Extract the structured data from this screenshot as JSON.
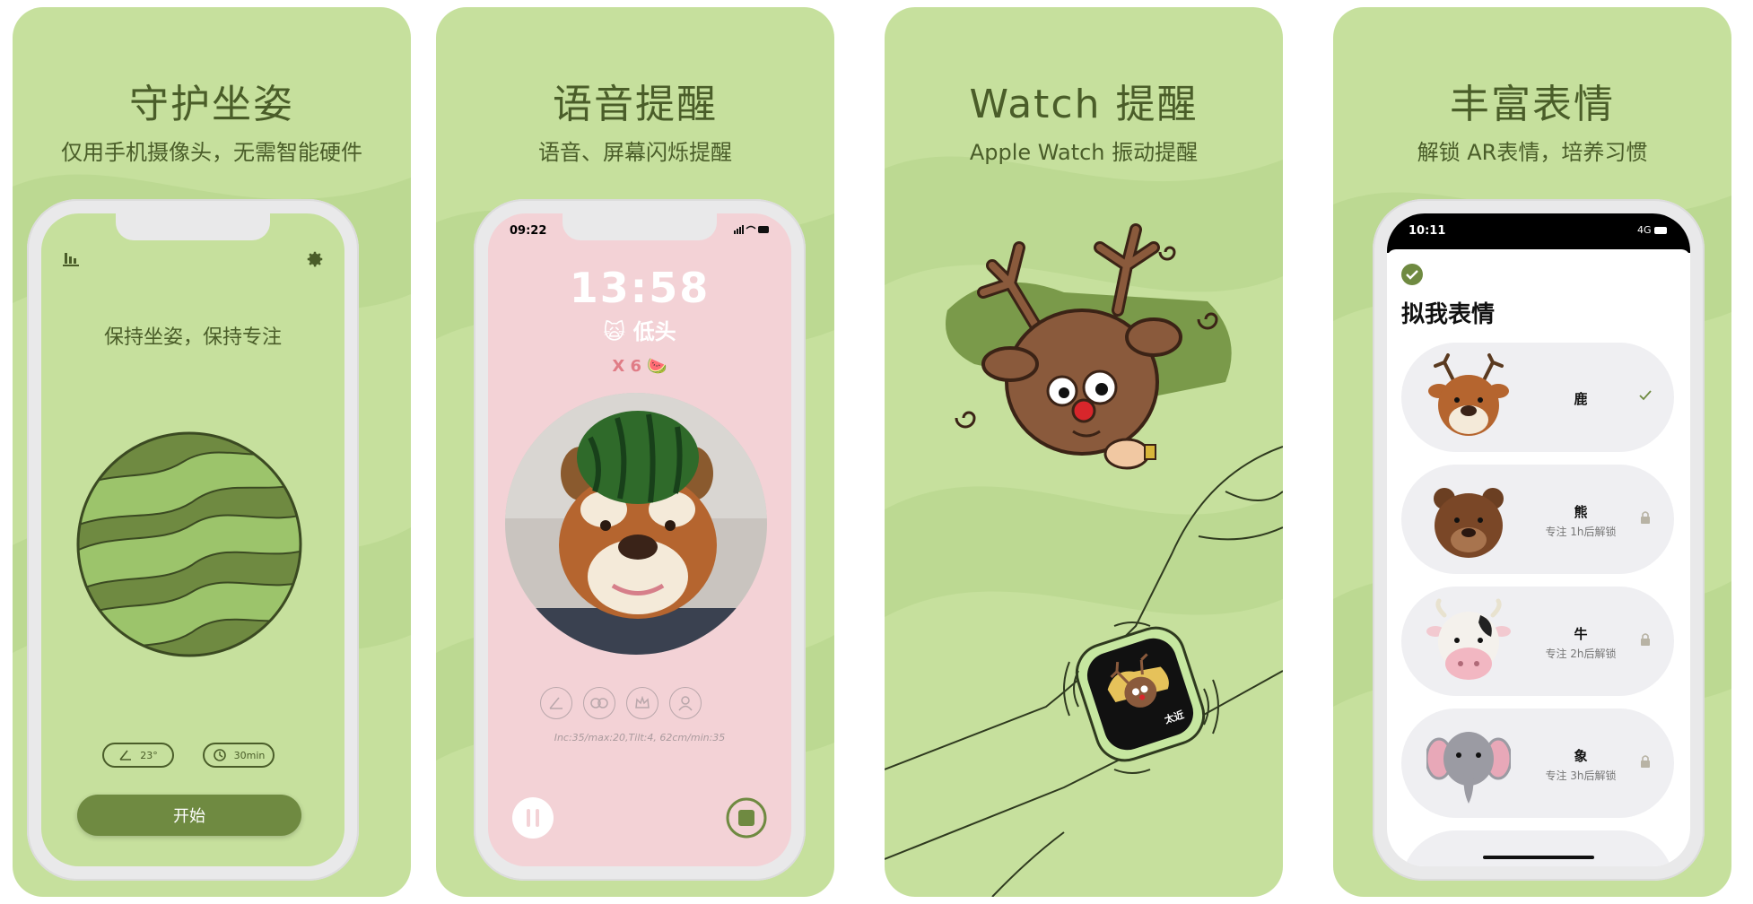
{
  "colors": {
    "panel_bg": "#c6e09d",
    "wave": "#b6d58b",
    "text_dark": "#4a5d29",
    "accent_green": "#6f8a41",
    "pink_screen": "#f3d2d6"
  },
  "panels": [
    {
      "title": "守护坐姿",
      "subtitle": "仅用手机摄像头，无需智能硬件",
      "screen": {
        "message": "保持坐姿，保持专注",
        "angle_label": "23°",
        "timer_label": "30min",
        "start_label": "开始",
        "icons": [
          "stats-icon",
          "gear-icon",
          "angle-icon",
          "timer-icon"
        ]
      }
    },
    {
      "title": "语音提醒",
      "subtitle": "语音、屏幕闪烁提醒",
      "screen": {
        "status_time": "09:22",
        "clock": "13:58",
        "alert_emoji": "🙀",
        "alert_text": "低头",
        "count_text": "X 6",
        "count_emoji": "🍉",
        "debug_text": "Inc:35/max:20,Tilt:4, 62cm/min:35",
        "icons": [
          "pause-icon",
          "stop-icon",
          "angle-mode-icon",
          "mask-mode-icon",
          "crown-mode-icon",
          "person-mode-icon"
        ]
      }
    },
    {
      "title": "Watch 提醒",
      "subtitle": "Apple Watch 振动提醒",
      "screen": {
        "watch_text": "太近"
      }
    },
    {
      "title": "丰富表情",
      "subtitle": "解锁 AR表情，培养习惯",
      "screen": {
        "status_time": "10:11",
        "status_signal": "4G",
        "heading": "拟我表情",
        "items": [
          {
            "name": "鹿",
            "hint": "",
            "state": "selected"
          },
          {
            "name": "熊",
            "hint": "专注 1h后解锁",
            "state": "locked"
          },
          {
            "name": "牛",
            "hint": "专注 2h后解锁",
            "state": "locked"
          },
          {
            "name": "象",
            "hint": "专注 3h后解锁",
            "state": "locked"
          }
        ]
      }
    }
  ]
}
